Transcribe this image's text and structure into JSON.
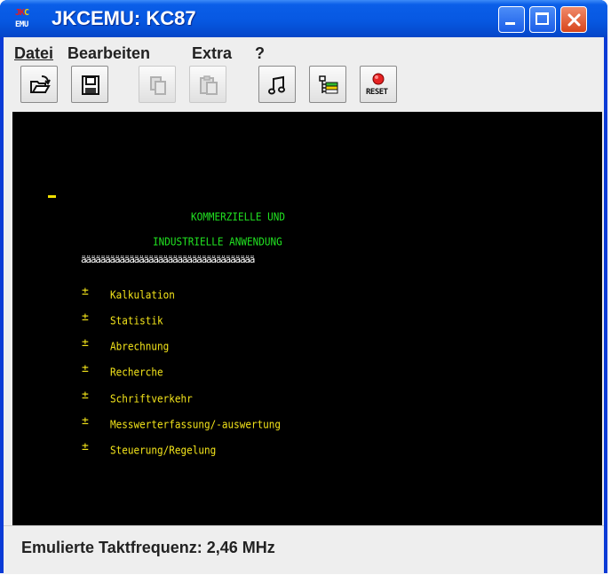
{
  "window": {
    "title": "JKCEMU: KC87",
    "icon": {
      "line1_a": "JK",
      "line1_b": "C",
      "line2": "EMU"
    },
    "buttons": {
      "minimize": "minimize-icon",
      "maximize": "maximize-icon",
      "close": "close-icon"
    }
  },
  "menu": {
    "items": [
      {
        "label": "Datei"
      },
      {
        "label": "Bearbeiten"
      },
      {
        "label": "Extra"
      },
      {
        "label": "?"
      }
    ]
  },
  "toolbar": {
    "buttons": [
      {
        "name": "open-icon"
      },
      {
        "name": "save-icon"
      },
      {
        "name": "copy-icon"
      },
      {
        "name": "paste-icon"
      },
      {
        "name": "audio-icon"
      },
      {
        "name": "settings-icon"
      },
      {
        "name": "reset-icon",
        "text": "RESET"
      }
    ]
  },
  "screen": {
    "cursor": "_",
    "heading1": "KOMMERZIELLE UND",
    "heading2": "INDUSTRIELLE ANWENDUNG",
    "rule": "ääääääääääääääääääääääääääääääääääää",
    "bullet": "±",
    "items": [
      "Kalkulation",
      "Statistik",
      "Abrechnung",
      "Recherche",
      "Schriftverkehr",
      "Messwerterfassung/-auswertung",
      "Steuerung/Regelung"
    ],
    "colors": {
      "background": "#000000",
      "green": "#21e221",
      "yellow": "#f3e41a"
    }
  },
  "status": {
    "text": "Emulierte Taktfrequenz: 2,46 MHz"
  }
}
